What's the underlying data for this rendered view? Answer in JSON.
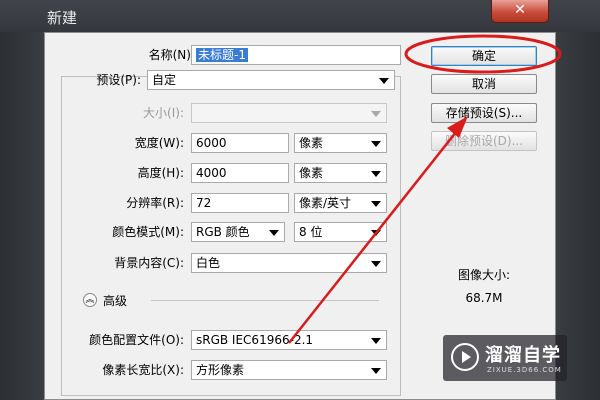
{
  "window": {
    "title": "新建",
    "close_glyph": "✕"
  },
  "form": {
    "name_label": "名称(N):",
    "name_value": "未标题-1",
    "preset_label": "预设(P):",
    "preset_value": "自定",
    "size_label": "大小(I):",
    "size_value": "",
    "width_label": "宽度(W):",
    "width_value": "6000",
    "width_unit": "像素",
    "height_label": "高度(H):",
    "height_value": "4000",
    "height_unit": "像素",
    "resolution_label": "分辨率(R):",
    "resolution_value": "72",
    "resolution_unit": "像素/英寸",
    "color_mode_label": "颜色模式(M):",
    "color_mode_value": "RGB 颜色",
    "bit_depth_value": "8 位",
    "background_label": "背景内容(C):",
    "background_value": "白色",
    "advanced_label": "高级",
    "color_profile_label": "颜色配置文件(O):",
    "color_profile_value": "sRGB IEC61966-2.1",
    "pixel_aspect_label": "像素长宽比(X):",
    "pixel_aspect_value": "方形像素"
  },
  "buttons": {
    "ok": "确定",
    "cancel": "取消",
    "save_preset": "存储预设(S)...",
    "delete_preset": "删除预设(D)..."
  },
  "info": {
    "image_size_label": "图像大小:",
    "image_size_value": "68.7M"
  },
  "watermark": {
    "brand": "溜溜自学",
    "url": "ZIXUE.3D66.COM"
  },
  "colors": {
    "annotation": "#d81c1c",
    "selection": "#3a7bd5"
  },
  "icons": [
    "close-icon",
    "dropdown-arrow-icon",
    "expand-collapse-icon",
    "play-logo-icon"
  ]
}
